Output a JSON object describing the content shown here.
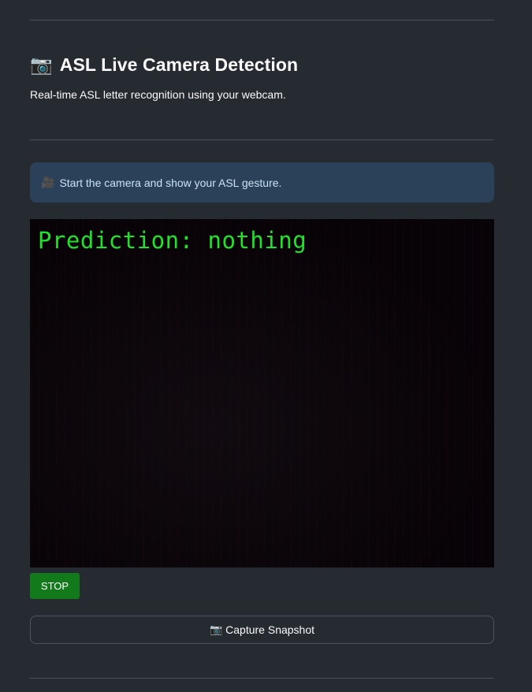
{
  "header": {
    "icon": "camera-icon",
    "icon_glyph": "📷",
    "title": "ASL Live Camera Detection",
    "subtitle": "Real-time ASL letter recognition using your webcam."
  },
  "info": {
    "icon": "video-camera-icon",
    "icon_glyph": "🎥",
    "text": "Start the camera and show your ASL gesture."
  },
  "video": {
    "overlay_text": "Prediction: nothing",
    "overlay_color": "#22e12a"
  },
  "controls": {
    "stop_label": "STOP",
    "stop_color": "#137a1c",
    "snapshot_icon": "camera-icon",
    "snapshot_icon_glyph": "📷",
    "snapshot_label": "Capture Snapshot"
  },
  "colors": {
    "background": "#262a31",
    "info_background": "#2b4059",
    "info_text": "#c7e3f5"
  }
}
